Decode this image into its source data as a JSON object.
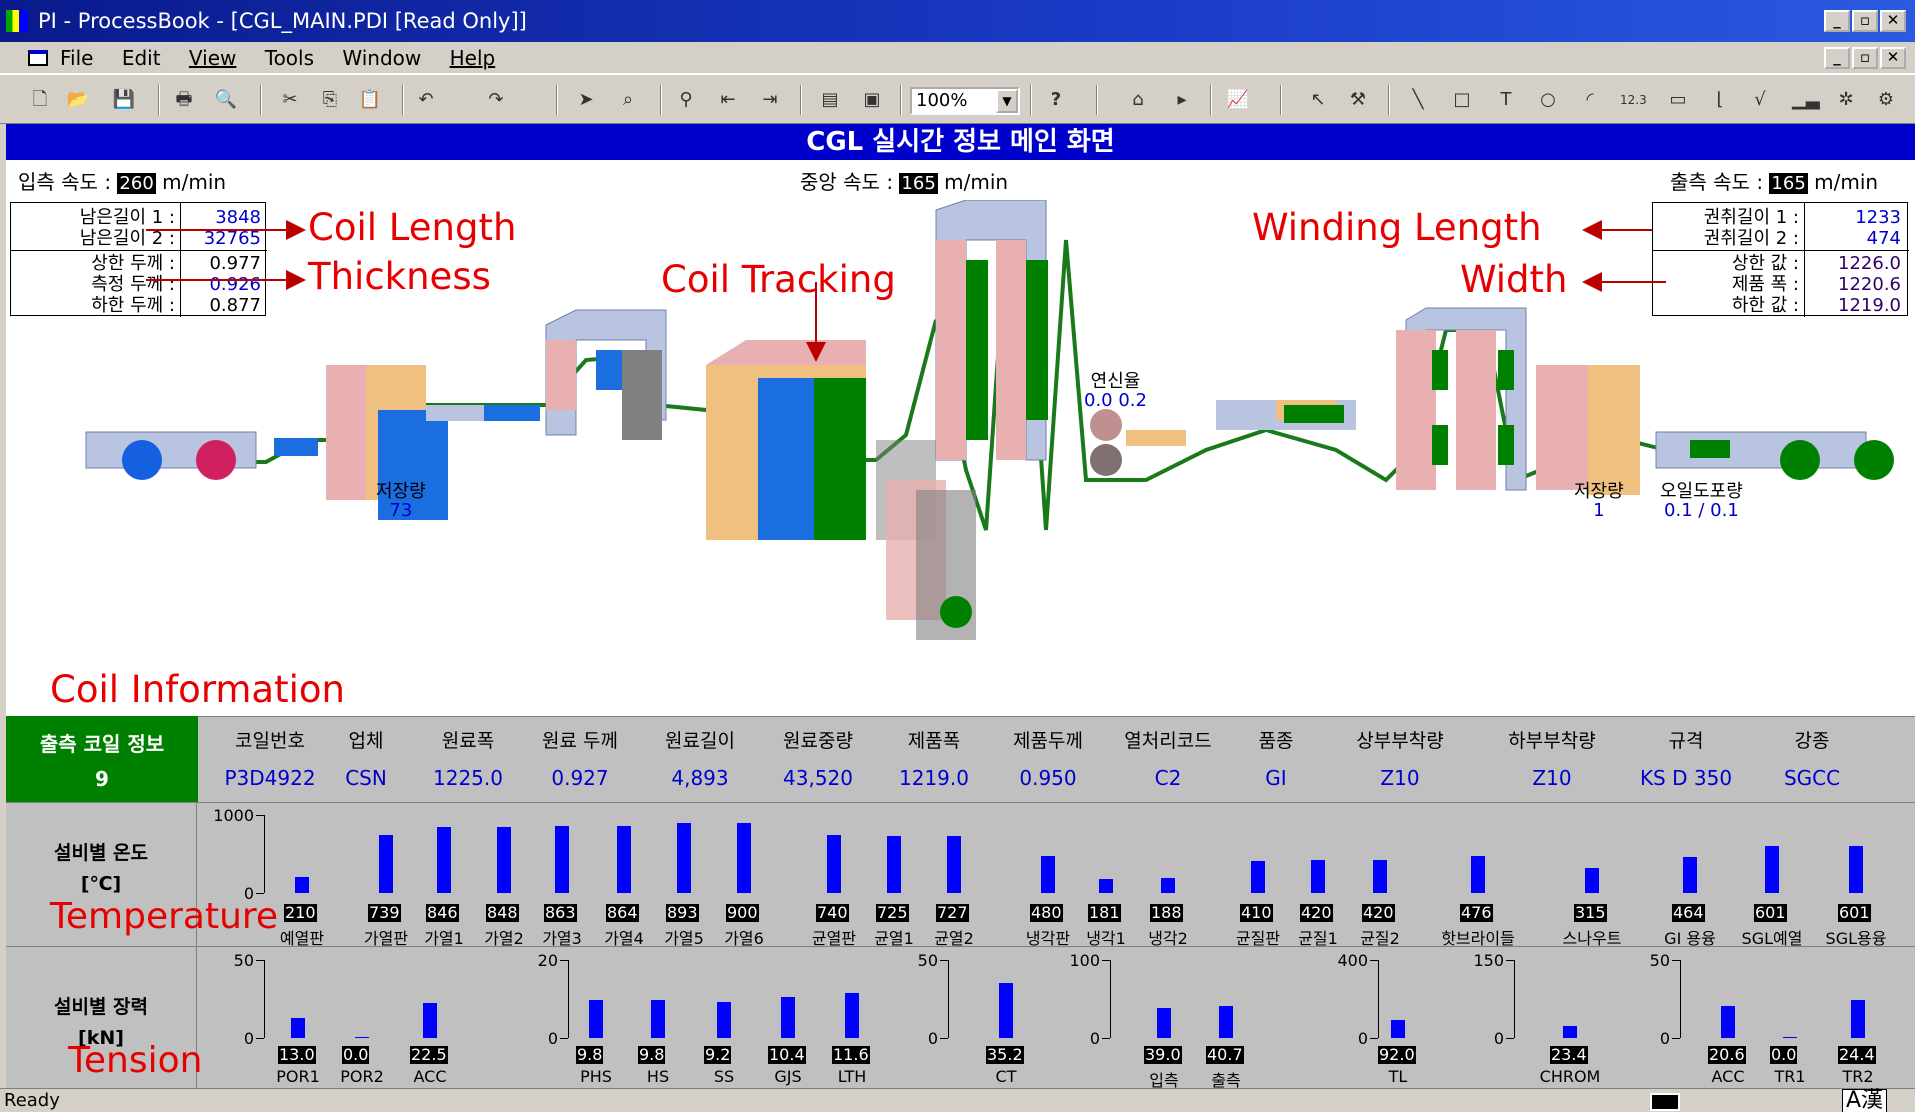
{
  "window": {
    "title": "PI - ProcessBook - [CGL_MAIN.PDI [Read Only]]"
  },
  "menu": [
    "File",
    "Edit",
    "View",
    "Tools",
    "Window",
    "Help"
  ],
  "toolbar": {
    "zoom": "100%"
  },
  "header": {
    "title": "CGL 실시간 정보 메인 화면"
  },
  "speeds": {
    "in_label": "입측 속도 :",
    "in_value": "260",
    "in_unit": "m/min",
    "mid_label": "중앙 속도 :",
    "mid_value": "165",
    "mid_unit": "m/min",
    "out_label": "출측 속도 :",
    "out_value": "165",
    "out_unit": "m/min"
  },
  "left_info": {
    "rows": [
      {
        "label": "남은길이 1 :",
        "value": "3848"
      },
      {
        "label": "남은길이 2 :",
        "value": "32765"
      },
      {
        "label": "상한 두께 :",
        "value": "0.977"
      },
      {
        "label": "측정 두께 :",
        "value": "0.926"
      },
      {
        "label": "하한 두께 :",
        "value": "0.877"
      }
    ]
  },
  "right_info": {
    "rows": [
      {
        "label": "권취길이 1 :",
        "value": "1233"
      },
      {
        "label": "권취길이 2 :",
        "value": "474"
      },
      {
        "label": "상한 값 :",
        "value": "1226.0"
      },
      {
        "label": "제품 폭 :",
        "value": "1220.6"
      },
      {
        "label": "하한 값 :",
        "value": "1219.0"
      }
    ]
  },
  "annotations": {
    "coil_length": "Coil Length",
    "thickness": "Thickness",
    "coil_tracking": "Coil Tracking",
    "winding_length": "Winding Length",
    "width": "Width",
    "coil_information": "Coil Information",
    "temperature": "Temperature",
    "tension": "Tension"
  },
  "process": {
    "storage_left_label": "저장량",
    "storage_left_value": "73",
    "elong_label": "연신율",
    "elong_values": "0.0  0.2",
    "storage_right_label": "저장량",
    "storage_right_value": "1",
    "oil_label": "오일도포량",
    "oil_values": "0.1 / 0.1"
  },
  "coil": {
    "box_title": "출측 코일 정보",
    "box_value": "9",
    "headers": [
      "코일번호",
      "업체",
      "원료폭",
      "원료 두께",
      "원료길이",
      "원료중량",
      "제품폭",
      "제품두께",
      "열처리코드",
      "품종",
      "상부부착량",
      "하부부착량",
      "규격",
      "강종"
    ],
    "values": [
      "P3D4922",
      "CSN",
      "1225.0",
      "0.927",
      "4,893",
      "43,520",
      "1219.0",
      "0.950",
      "C2",
      "GI",
      "Z10",
      "Z10",
      "KS D 350",
      "SGCC"
    ]
  },
  "temp": {
    "title": "설비별 온도",
    "unit": "[℃]",
    "ymax": "1000",
    "ymin": "0"
  },
  "tension": {
    "title": "설비별 장력",
    "unit": "[kN]"
  },
  "chart_data": [
    {
      "type": "bar",
      "title": "설비별 온도",
      "ylabel": "[℃]",
      "ylim": [
        0,
        1000
      ],
      "categories": [
        "예열판",
        "가열판",
        "가열1",
        "가열2",
        "가열3",
        "가열4",
        "가열5",
        "가열6",
        "균열판",
        "균열1",
        "균열2",
        "냉각판",
        "냉각1",
        "냉각2",
        "균질판",
        "균질1",
        "균질2",
        "핫브라이들",
        "스나우트",
        "GI 용융",
        "SGL예열",
        "SGL용융"
      ],
      "values": [
        210,
        739,
        846,
        848,
        863,
        864,
        893,
        900,
        740,
        725,
        727,
        480,
        181,
        188,
        410,
        420,
        420,
        476,
        315,
        464,
        601,
        601
      ],
      "labels": [
        "210",
        "739",
        "846",
        "848",
        "863",
        "864",
        "893",
        "900",
        "740",
        "725",
        "727",
        "480",
        "181",
        "188",
        "410",
        "420",
        "420",
        "476",
        "315",
        "464",
        "601",
        "601"
      ]
    },
    {
      "type": "bar",
      "title": "설비별 장력",
      "ylabel": "[kN]",
      "ylim": [
        0,
        50
      ],
      "categories": [
        "POR1",
        "POR2",
        "ACC"
      ],
      "values": [
        13.0,
        0.0,
        22.5
      ],
      "labels": [
        "13.0",
        "0.0",
        "22.5"
      ]
    },
    {
      "type": "bar",
      "ylim": [
        0,
        20
      ],
      "categories": [
        "PHS",
        "HS",
        "SS",
        "GJS",
        "LTH"
      ],
      "values": [
        9.8,
        9.8,
        9.2,
        10.4,
        11.6
      ],
      "labels": [
        "9.8",
        "9.8",
        "9.2",
        "10.4",
        "11.6"
      ]
    },
    {
      "type": "bar",
      "ylim": [
        0,
        50
      ],
      "categories": [
        "CT"
      ],
      "values": [
        35.2
      ],
      "labels": [
        "35.2"
      ]
    },
    {
      "type": "bar",
      "ylim": [
        0,
        100
      ],
      "categories": [
        "입측",
        "출측"
      ],
      "values": [
        39.0,
        40.7
      ],
      "labels": [
        "39.0",
        "40.7"
      ]
    },
    {
      "type": "bar",
      "ylim": [
        0,
        400
      ],
      "categories": [
        "TL"
      ],
      "values": [
        92.0
      ],
      "labels": [
        "92.0"
      ]
    },
    {
      "type": "bar",
      "ylim": [
        0,
        150
      ],
      "categories": [
        "CHROM"
      ],
      "values": [
        23.4
      ],
      "labels": [
        "23.4"
      ]
    },
    {
      "type": "bar",
      "ylim": [
        0,
        50
      ],
      "categories": [
        "ACC",
        "TR1",
        "TR2"
      ],
      "values": [
        20.6,
        0.0,
        24.4
      ],
      "labels": [
        "20.6",
        "0.0",
        "24.4"
      ]
    }
  ],
  "status": {
    "text": "Ready",
    "ime": "A漢"
  }
}
